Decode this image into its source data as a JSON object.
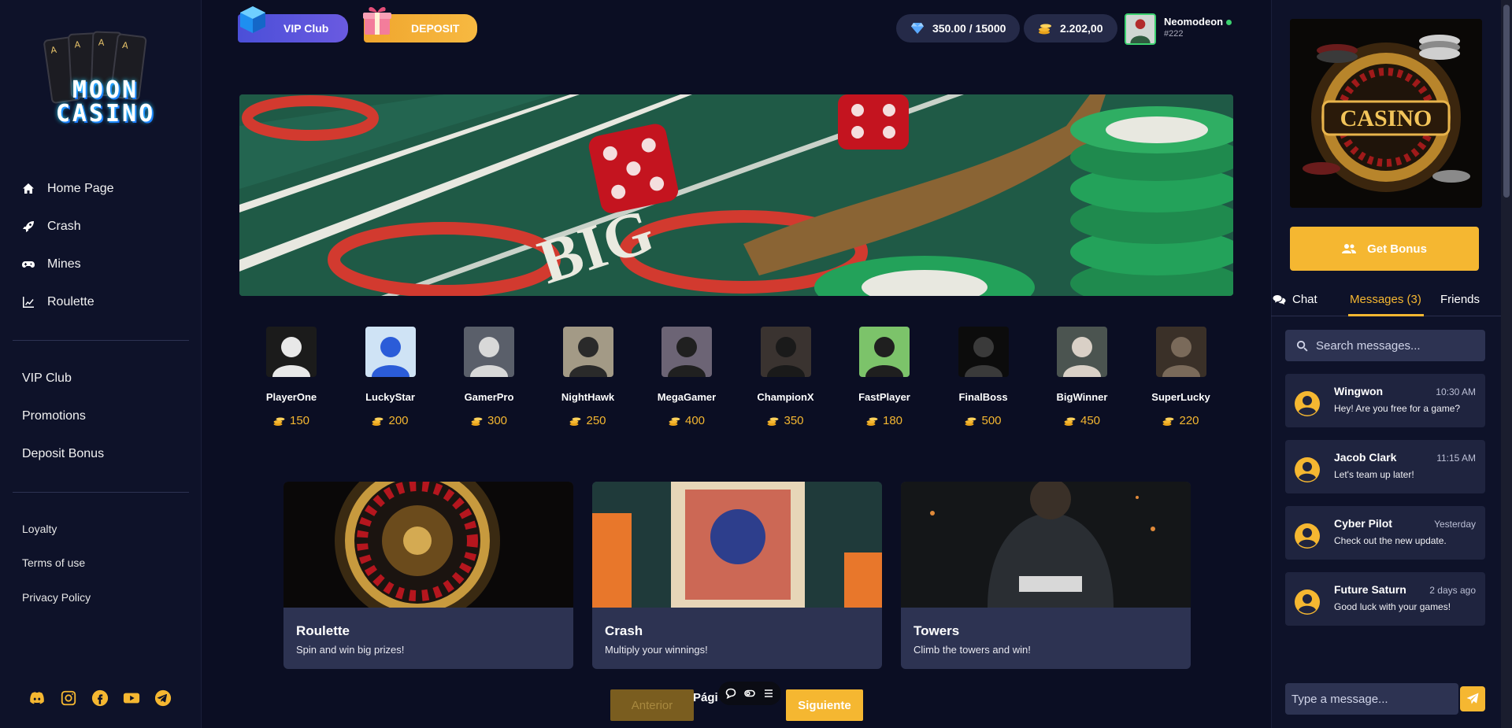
{
  "brand": {
    "line1": "MOON",
    "line2": "CASINO"
  },
  "sidebar": {
    "nav": [
      {
        "label": "Home Page",
        "icon": "home-icon"
      },
      {
        "label": "Crash",
        "icon": "rocket-icon"
      },
      {
        "label": "Mines",
        "icon": "gamepad-icon"
      },
      {
        "label": "Roulette",
        "icon": "chart-icon"
      }
    ],
    "secondary": [
      "VIP Club",
      "Promotions",
      "Deposit Bonus"
    ],
    "footer_links": [
      "Loyalty",
      "Terms of use",
      "Privacy Policy"
    ],
    "socials": [
      "discord-icon",
      "instagram-icon",
      "facebook-icon",
      "youtube-icon",
      "telegram-icon"
    ]
  },
  "topbar": {
    "vip_label": "VIP Club",
    "deposit_label": "DEPOSIT",
    "xp": "350.00 / 15000",
    "balance": "2.202,00",
    "user": {
      "name": "Neomodeon",
      "id": "#222",
      "status": "online"
    }
  },
  "players": [
    {
      "name": "PlayerOne",
      "coins": "150"
    },
    {
      "name": "LuckyStar",
      "coins": "200"
    },
    {
      "name": "GamerPro",
      "coins": "300"
    },
    {
      "name": "NightHawk",
      "coins": "250"
    },
    {
      "name": "MegaGamer",
      "coins": "400"
    },
    {
      "name": "ChampionX",
      "coins": "350"
    },
    {
      "name": "FastPlayer",
      "coins": "180"
    },
    {
      "name": "FinalBoss",
      "coins": "500"
    },
    {
      "name": "BigWinner",
      "coins": "450"
    },
    {
      "name": "SuperLucky",
      "coins": "220"
    }
  ],
  "games": [
    {
      "title": "Roulette",
      "desc": "Spin and win big prizes!"
    },
    {
      "title": "Crash",
      "desc": "Multiply your winnings!"
    },
    {
      "title": "Towers",
      "desc": "Climb the towers and win!"
    }
  ],
  "pager": {
    "prev": "Anterior",
    "label": "Pági",
    "next": "Siguiente"
  },
  "right": {
    "promo_word": "CASINO",
    "bonus_label": "Get Bonus",
    "tabs": [
      "Chat",
      "Messages (3)",
      "Friends"
    ],
    "active_tab": "Messages (3)",
    "search_placeholder": "Search messages...",
    "messages": [
      {
        "name": "Wingwon",
        "time": "10:30 AM",
        "text": "Hey! Are you free for a game?"
      },
      {
        "name": "Jacob Clark",
        "time": "11:15 AM",
        "text": "Let's team up later!"
      },
      {
        "name": "Cyber Pilot",
        "time": "Yesterday",
        "text": "Check out the new update."
      },
      {
        "name": "Future Saturn",
        "time": "2 days ago",
        "text": "Good luck with your games!"
      }
    ],
    "type_placeholder": "Type a message..."
  },
  "colors": {
    "accent": "#f5b731",
    "bg": "#0b0e23",
    "panel": "#0e1229",
    "card": "#2d3352",
    "vip": "#5b54dc",
    "online": "#3bd16f"
  }
}
